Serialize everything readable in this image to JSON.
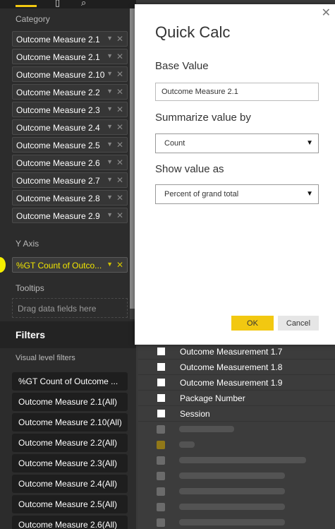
{
  "left_pane": {
    "category_label": "Category",
    "category_items": [
      "Outcome Measure 2.1",
      "Outcome Measure 2.1",
      "Outcome Measure 2.10",
      "Outcome Measure 2.2",
      "Outcome Measure 2.3",
      "Outcome Measure 2.4",
      "Outcome Measure 2.5",
      "Outcome Measure 2.6",
      "Outcome Measure 2.7",
      "Outcome Measure 2.8",
      "Outcome Measure 2.9"
    ],
    "yaxis_label": "Y Axis",
    "yaxis_item": "%GT Count of Outco...",
    "tooltips_label": "Tooltips",
    "tooltips_placeholder": "Drag data fields here",
    "dropdown_glyph": "▼",
    "remove_glyph": "✕"
  },
  "filters": {
    "heading": "Filters",
    "subheading": "Visual level filters",
    "items": [
      "%GT Count of Outcome ...",
      "Outcome Measure 2.1(All)",
      "Outcome Measure 2.10(All)",
      "Outcome Measure 2.2(All)",
      "Outcome Measure 2.3(All)",
      "Outcome Measure 2.4(All)",
      "Outcome Measure 2.5(All)",
      "Outcome Measure 2.6(All)"
    ]
  },
  "fields_list": {
    "items": [
      "Outcome Measurement 1.7",
      "Outcome Measurement 1.8",
      "Outcome Measurement 1.9",
      "Package Number",
      "Session"
    ]
  },
  "dialog": {
    "title": "Quick Calc",
    "close_glyph": "✕",
    "base_value_label": "Base Value",
    "base_value": "Outcome Measure 2.1",
    "summarize_label": "Summarize value by",
    "summarize_value": "Count",
    "show_as_label": "Show value as",
    "show_as_value": "Percent of grand total",
    "select_arrow": "▼",
    "ok_label": "OK",
    "cancel_label": "Cancel"
  },
  "colors": {
    "accent": "#f2c811",
    "highlight": "#f5ee00",
    "pane_bg": "#2c2c2c",
    "dialog_bg": "#ffffff"
  }
}
